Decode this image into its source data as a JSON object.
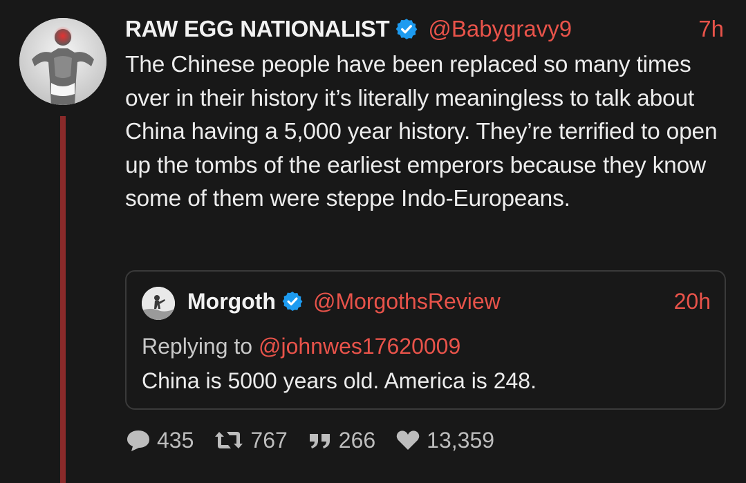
{
  "tweet": {
    "display_name": "RAW EGG NATIONALIST",
    "handle": "@Babygravy9",
    "time": "7h",
    "text": "The Chinese people have been replaced so many times over in their history it’s literally meaningless to talk about China having a 5,000 year history. They’re terrified to open up the tombs of the earliest emperors because they know some of them were steppe Indo-Europeans.",
    "avatar_icon": "bodybuilder-avatar",
    "verified_icon": "verified-badge-icon"
  },
  "quote": {
    "display_name": "Morgoth",
    "handle": "@MorgothsReview",
    "time": "20h",
    "replying_prefix": "Replying to",
    "replying_to": "@johnwes17620009",
    "text": "China is 5000 years old. America is 248.",
    "avatar_icon": "figure-avatar"
  },
  "actions": {
    "replies": "435",
    "retweets": "767",
    "quotes": "266",
    "likes": "13,359"
  },
  "colors": {
    "background": "#181818",
    "accent": "#e8534a",
    "verified": "#1d9bf0",
    "thread_line": "#8a2a2a",
    "icon_gray": "#bdbdbd"
  }
}
